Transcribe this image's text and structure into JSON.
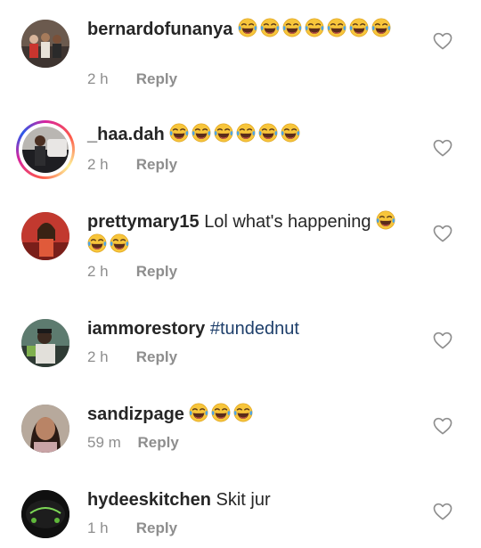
{
  "colors": {
    "username": "#262626",
    "meta": "#8e8e8e",
    "hashtag": "#1e3f6b",
    "heart": "#8e8e8e"
  },
  "icons": {
    "like": "heart-outline-icon",
    "emoji": "face-with-tears-of-joy-icon"
  },
  "comments": [
    {
      "username": "bernardofunanya",
      "text": "",
      "emoji_count": 7,
      "time": "2 h",
      "reply": "Reply"
    },
    {
      "username": "_haa.dah",
      "text": "",
      "emoji_count": 6,
      "time": "2 h",
      "reply": "Reply"
    },
    {
      "username": "prettymary15",
      "text": "Lol what's happening",
      "emoji_count": 3,
      "time": "2 h",
      "reply": "Reply"
    },
    {
      "username": "iammorestory",
      "text": "",
      "hashtag": "#tundednut",
      "emoji_count": 0,
      "time": "2 h",
      "reply": "Reply"
    },
    {
      "username": "sandizpage",
      "text": "",
      "emoji_count": 3,
      "time": "59 m",
      "reply": "Reply"
    },
    {
      "username": "hydeeskitchen",
      "text": "Skit jur",
      "emoji_count": 0,
      "time": "1 h",
      "reply": "Reply"
    }
  ]
}
